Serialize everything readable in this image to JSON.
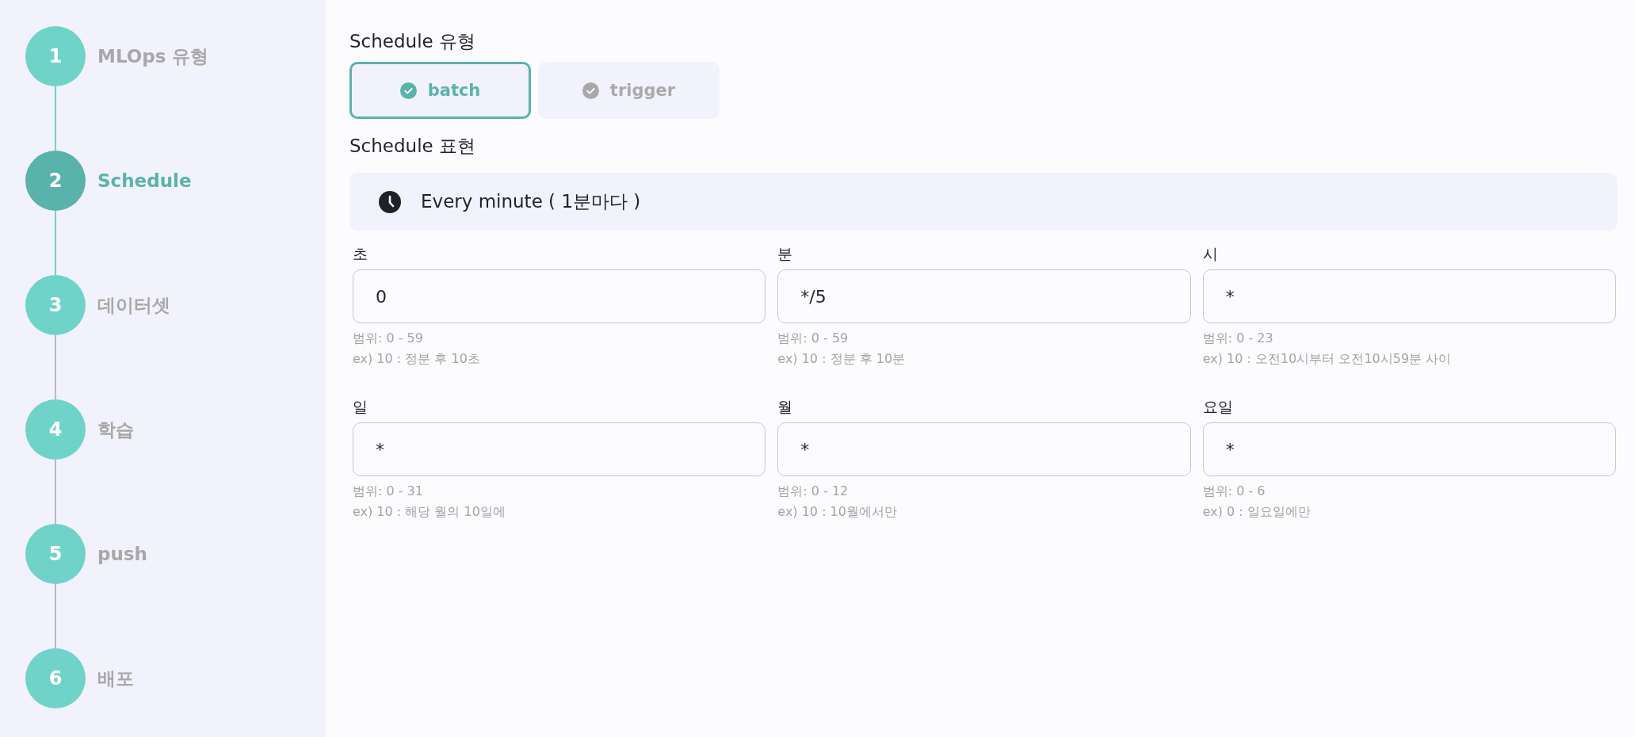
{
  "steps": [
    {
      "number": "1",
      "label": "MLOps 유형",
      "selected": false
    },
    {
      "number": "2",
      "label": "Schedule",
      "selected": true
    },
    {
      "number": "3",
      "label": "데이터셋",
      "selected": false
    },
    {
      "number": "4",
      "label": "학습",
      "selected": false
    },
    {
      "number": "5",
      "label": "push",
      "selected": false
    },
    {
      "number": "6",
      "label": "배포",
      "selected": false
    }
  ],
  "schedule_type": {
    "title": "Schedule 유형",
    "options": [
      {
        "label": "batch",
        "selected": true
      },
      {
        "label": "trigger",
        "selected": false
      }
    ]
  },
  "schedule_expression": {
    "title": "Schedule 표현",
    "summary": "Every minute ( 1분마다 )"
  },
  "fields": [
    {
      "label": "초",
      "value": "0",
      "range": "범위: 0 - 59",
      "example": "ex) 10 : 정분 후 10초"
    },
    {
      "label": "분",
      "value": "*/5",
      "range": "범위: 0 - 59",
      "example": "ex) 10 : 정분 후 10분"
    },
    {
      "label": "시",
      "value": "*",
      "range": "범위: 0 - 23",
      "example": "ex) 10 : 오전10시부터 오전10시59분 사이"
    },
    {
      "label": "일",
      "value": "*",
      "range": "범위: 0 - 31",
      "example": "ex) 10 : 해당 월의 10일에"
    },
    {
      "label": "월",
      "value": "*",
      "range": "범위: 0 - 12",
      "example": "ex) 10 : 10월에서만"
    },
    {
      "label": "요일",
      "value": "*",
      "range": "범위: 0 - 6",
      "example": "ex) 0 : 일요일에만"
    }
  ]
}
